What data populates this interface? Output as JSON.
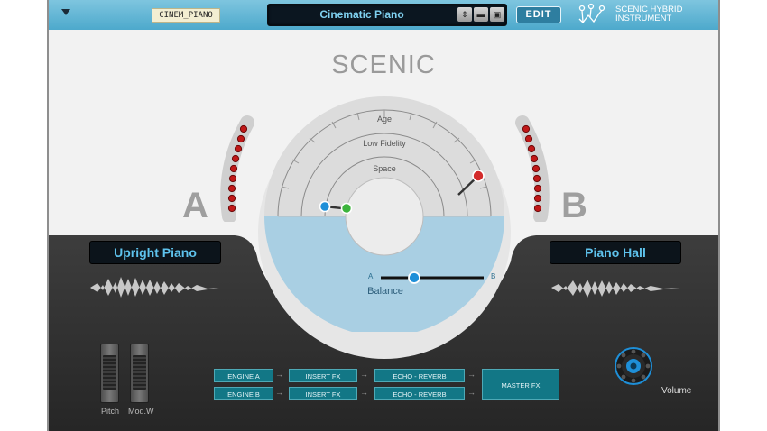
{
  "header": {
    "preset_tag": "CINEM_PIANO",
    "preset_name": "Cinematic Piano",
    "edit_label": "EDIT",
    "brand_line1": "SCENIC HYBRID",
    "brand_line2": "INSTRUMENT"
  },
  "title": "SCENIC",
  "dial": {
    "labels": [
      "Age",
      "Low Fidelity",
      "Space"
    ]
  },
  "balance": {
    "label": "Balance",
    "a_label": "A",
    "b_label": "B"
  },
  "side_a": {
    "letter": "A",
    "sound": "Upright Piano"
  },
  "side_b": {
    "letter": "B",
    "sound": "Piano Hall"
  },
  "controllers": {
    "pitch_label": "Pitch",
    "mod_label": "Mod.W"
  },
  "fx_chain": {
    "engine_a": "ENGINE A",
    "engine_b": "ENGINE B",
    "insert_fx_a": "INSERT FX",
    "insert_fx_b": "INSERT FX",
    "echo_reverb_a": "ECHO - REVERB",
    "echo_reverb_b": "ECHO - REVERB",
    "master_fx": "MASTER FX"
  },
  "volume": {
    "label": "Volume"
  },
  "colors": {
    "accent": "#5ec2ec",
    "chain": "#127786",
    "knob_a": "#1e8fd8",
    "knob_b": "#d32b2b"
  }
}
